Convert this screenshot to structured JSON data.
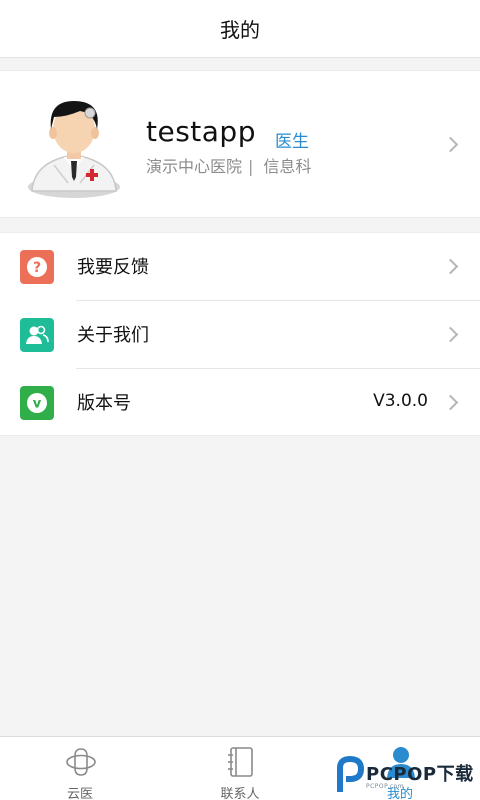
{
  "header": {
    "title": "我的"
  },
  "profile": {
    "name": "testapp",
    "role": "医生",
    "hospital": "演示中心医院",
    "separator": "|",
    "department": "信息科"
  },
  "menu": {
    "items": [
      {
        "label": "我要反馈",
        "icon": "feedback-question-icon",
        "color": "#ec6f57"
      },
      {
        "label": "关于我们",
        "icon": "about-us-people-icon",
        "color": "#1fbd97"
      },
      {
        "label": "版本号",
        "value": "V3.0.0",
        "icon": "version-v-icon",
        "color": "#2fae4a"
      }
    ]
  },
  "tabbar": {
    "tabs": [
      {
        "label": "云医",
        "icon": "cloud-doctor-icon"
      },
      {
        "label": "联系人",
        "icon": "contacts-book-icon"
      },
      {
        "label": "我的",
        "icon": "user-profile-icon",
        "active": true
      }
    ]
  },
  "watermark": {
    "brand": "PCPOP下载",
    "sub": "PCPOP.com"
  },
  "colors": {
    "accent": "#2a8ccf",
    "background": "#f4f4f4"
  }
}
